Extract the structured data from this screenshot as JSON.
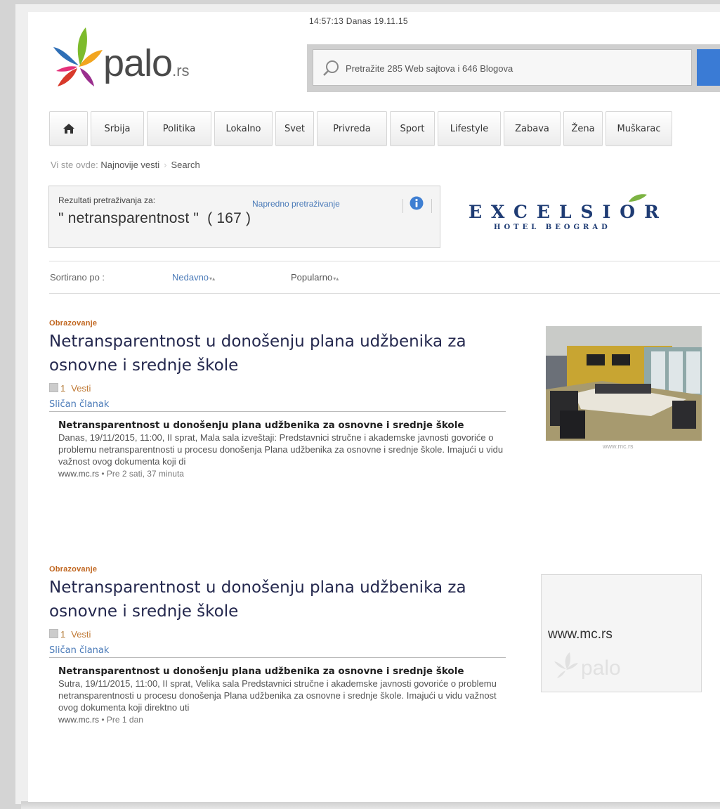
{
  "header": {
    "clock": "14:57:13 Danas 19.11.15",
    "logo_text": "palo",
    "logo_suffix": ".rs",
    "search_placeholder": "Pretražite 285 Web sajtova i 646 Blogova"
  },
  "nav": {
    "home_icon": "home-icon",
    "items": [
      "Srbija",
      "Politika",
      "Lokalno",
      "Svet",
      "Privreda",
      "Sport",
      "Lifestyle",
      "Zabava",
      "Žena",
      "Muškarac"
    ]
  },
  "breadcrumb": {
    "prefix": "Vi ste ovde:",
    "items": [
      "Najnovije vesti",
      "Search"
    ]
  },
  "results": {
    "label": "Rezultati pretraživanja za:",
    "query": "\" netransparentnost \"",
    "count": "( 167 )",
    "advanced": "Napredno pretraživanje"
  },
  "ad": {
    "title": "EXCELSIOR",
    "subtitle": "HOTEL BEOGRAD"
  },
  "sort": {
    "label": "Sortirano po :",
    "recent": "Nedavno",
    "popular": "Popularno"
  },
  "articles": [
    {
      "category": "Obrazovanje",
      "title": "Netransparentnost u donošenju plana udžbenika za osnovne i srednje škole",
      "count": "1",
      "vesti": "Vesti",
      "similar": "Sličan članak",
      "sub_title": "Netransparentnost u donošenju plana udžbenika za osnovne i srednje škole",
      "snippet": "Danas, 19/11/2015, 11:00, II sprat, Mala sala izveštaji: Predstavnici stručne i akademske javnosti govoriće o problemu netransparentnosti u procesu donošenja Plana udžbenika za osnovne i srednje škole. Imajući u vidu važnost ovog dokumenta koji di",
      "source": "www.mc.rs",
      "time": "Pre 2 sati, 37 minuta",
      "image_caption": "www.mc.rs"
    },
    {
      "category": "Obrazovanje",
      "title": "Netransparentnost u donošenju plana udžbenika za osnovne i srednje škole",
      "count": "1",
      "vesti": "Vesti",
      "similar": "Sličan članak",
      "sub_title": "Netransparentnost u donošenju plana udžbenika za osnovne i srednje škole",
      "snippet": "Sutra, 19/11/2015, 11:00, II sprat, Velika sala Predstavnici stručne i akademske javnosti govoriće o problemu netransparentnosti u procesu donošenja Plana udžbenika za osnovne i srednje škole. Imajući u vidu važnost ovog dokumenta koji direktno uti",
      "source": "www.mc.rs",
      "time": "Pre 1 dan",
      "placeholder_text": "www.mc.rs",
      "placeholder_logo": "palo"
    }
  ],
  "separator": "•"
}
